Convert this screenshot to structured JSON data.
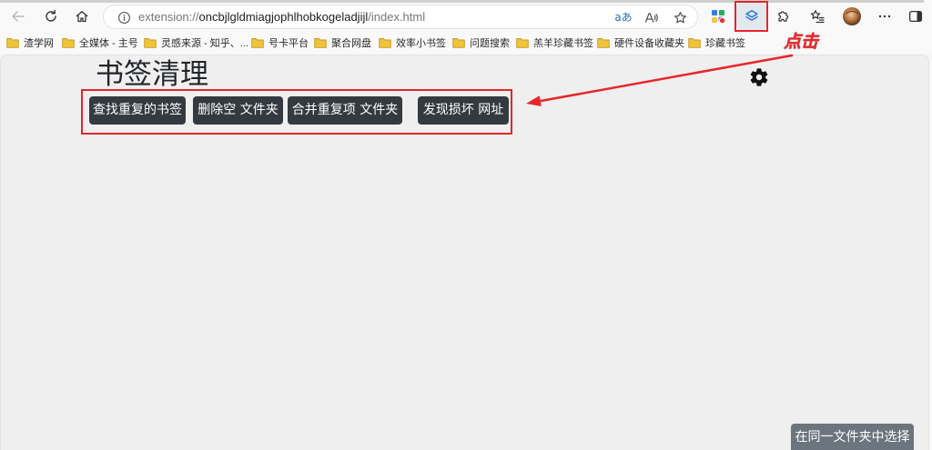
{
  "browser": {
    "url": {
      "scheme": "extension://",
      "host": "oncbjlgldmiagjophlhobkogeladjijl",
      "path": "/index.html"
    },
    "translate_glyph": "aあ"
  },
  "bookmarks": [
    {
      "label": "渣学网"
    },
    {
      "label": "全媒体 - 主号"
    },
    {
      "label": "灵感来源 - 知乎、..."
    },
    {
      "label": "号卡平台"
    },
    {
      "label": "聚合网盘"
    },
    {
      "label": "效率小书签"
    },
    {
      "label": "问题搜索"
    },
    {
      "label": "羔羊珍藏书签"
    },
    {
      "label": "硬件设备收藏夹"
    },
    {
      "label": "珍藏书签"
    }
  ],
  "annotation": {
    "text": "点击"
  },
  "page": {
    "title": "书签清理",
    "buttons": [
      {
        "label": "查找重复的书签"
      },
      {
        "label": "删除空 文件夹"
      },
      {
        "label": "合并重复项 文件夹"
      },
      {
        "label": "发现损坏 网址"
      }
    ],
    "bottom_button": {
      "label": "在同一文件夹中选择"
    }
  },
  "icons": {
    "back": "back-arrow-icon",
    "refresh": "refresh-icon",
    "home": "home-icon",
    "site_info": "info-icon",
    "translate": "translate-icon",
    "read_aloud": "read-aloud-icon",
    "favorite": "star-icon",
    "extension_badge": "colorful-extension-icon",
    "extension_active": "layers-icon",
    "extensions": "puzzle-icon",
    "favorites": "favorites-icon",
    "profile": "avatar-icon",
    "more": "more-dots-icon",
    "sidebar": "sidebar-icon",
    "bookmark_folder": "folder-icon",
    "settings": "gear-icon"
  },
  "colors": {
    "action_button": "#343a40",
    "secondary_button": "#6c757d",
    "annotation": "#e8262b",
    "extension_accent": "#2b7bd3",
    "folder": "#f0c33c"
  }
}
